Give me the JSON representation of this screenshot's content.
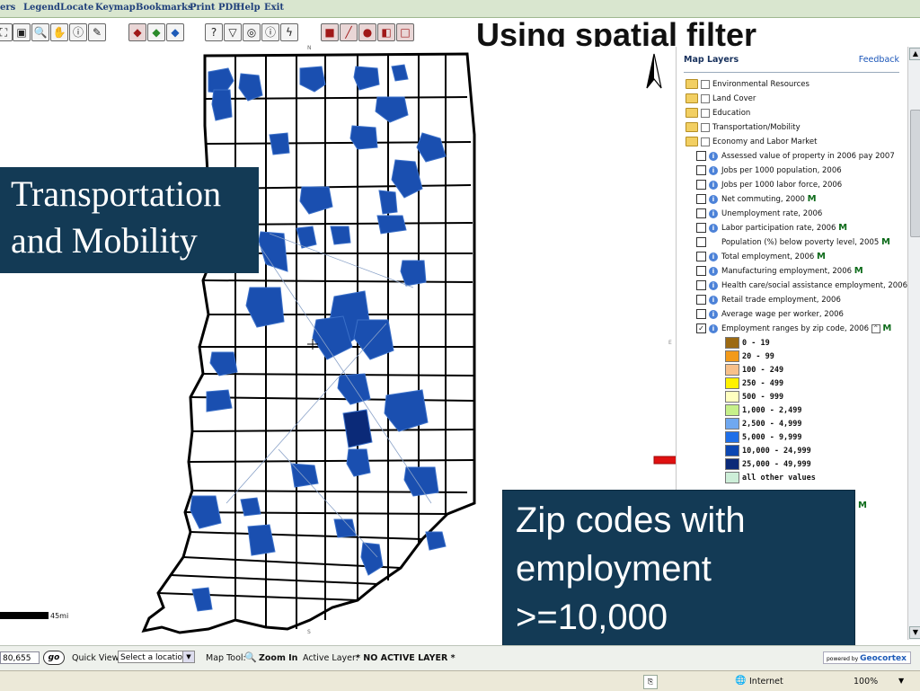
{
  "menu": [
    "ers",
    "Legend",
    "Locate",
    "Keymap",
    "Bookmarks",
    "Print PDF",
    "Help",
    "Exit"
  ],
  "slide_title": "Using spatial filter",
  "callouts": {
    "left": [
      "Transportation",
      "and Mobility"
    ],
    "right": [
      "Zip codes with",
      "employment",
      ">=10,000"
    ]
  },
  "panel": {
    "title": "Map Layers",
    "feedback": "Feedback",
    "folders": [
      "Environmental Resources",
      "Land Cover",
      "Education",
      "Transportation/Mobility",
      "Economy and Labor Market"
    ],
    "layers": [
      {
        "label": "Assessed value of property in 2006 pay 2007",
        "info": true,
        "checked": false,
        "m": ""
      },
      {
        "label": "Jobs per 1000 population, 2006",
        "info": true,
        "checked": false,
        "m": ""
      },
      {
        "label": "Jobs per 1000 labor force, 2006",
        "info": true,
        "checked": false,
        "m": ""
      },
      {
        "label": "Net commuting, 2000",
        "info": true,
        "checked": false,
        "m": "M"
      },
      {
        "label": "Unemployment rate, 2006",
        "info": true,
        "checked": false,
        "m": ""
      },
      {
        "label": "Labor participation rate, 2006",
        "info": true,
        "checked": false,
        "m": "M"
      },
      {
        "label": "Population (%) below poverty level, 2005",
        "info": false,
        "checked": false,
        "m": "M"
      },
      {
        "label": "Total employment, 2006",
        "info": true,
        "checked": false,
        "m": "M"
      },
      {
        "label": "Manufacturing employment, 2006",
        "info": true,
        "checked": false,
        "m": "M"
      },
      {
        "label": "Health care/social assistance employment, 2006",
        "info": true,
        "checked": false,
        "m": ""
      },
      {
        "label": "Retail trade employment, 2006",
        "info": true,
        "checked": false,
        "m": ""
      },
      {
        "label": "Average wage per worker, 2006",
        "info": true,
        "checked": false,
        "m": ""
      },
      {
        "label": "Employment ranges by zip code, 2006",
        "info": true,
        "checked": true,
        "m": "M"
      }
    ],
    "legend": [
      {
        "label": "0 - 19",
        "color": "#9c6a12"
      },
      {
        "label": "20 - 99",
        "color": "#f29a1a"
      },
      {
        "label": "100 - 249",
        "color": "#f7c08a"
      },
      {
        "label": "250 - 499",
        "color": "#fff200"
      },
      {
        "label": "500 - 999",
        "color": "#ffffc0"
      },
      {
        "label": "1,000 - 2,499",
        "color": "#c6f08a"
      },
      {
        "label": "2,500 - 4,999",
        "color": "#6fa8f0"
      },
      {
        "label": "5,000 - 9,999",
        "color": "#1f6fe8"
      },
      {
        "label": "10,000 - 24,999",
        "color": "#0c47b2"
      },
      {
        "label": "25,000 - 49,999",
        "color": "#0b2a78"
      },
      {
        "label": "all other values",
        "color": "#cdeed8"
      }
    ],
    "trailing_m": "M"
  },
  "map": {
    "scale_label": "45mi",
    "north_label": "N",
    "edge_letter": "E",
    "bottom_marker": "S"
  },
  "status": {
    "coords": "80,655",
    "go": "go",
    "quick_view_label": "Quick View:",
    "quick_view_value": "Select a location",
    "map_tool_label": "Map Tool:",
    "map_tool_value": "Zoom In",
    "active_layer_label": "Active Layer:",
    "active_layer_value": "* NO ACTIVE LAYER *",
    "powered_by": "powered by",
    "brand": "Geocortex"
  },
  "ie": {
    "zone": "Internet",
    "zoom": "100%"
  },
  "colors": {
    "callout_bg": "#133a55",
    "zip_fill": "#1a4fb0",
    "zip_dark": "#0b2a78",
    "arrow": "#e01010"
  }
}
